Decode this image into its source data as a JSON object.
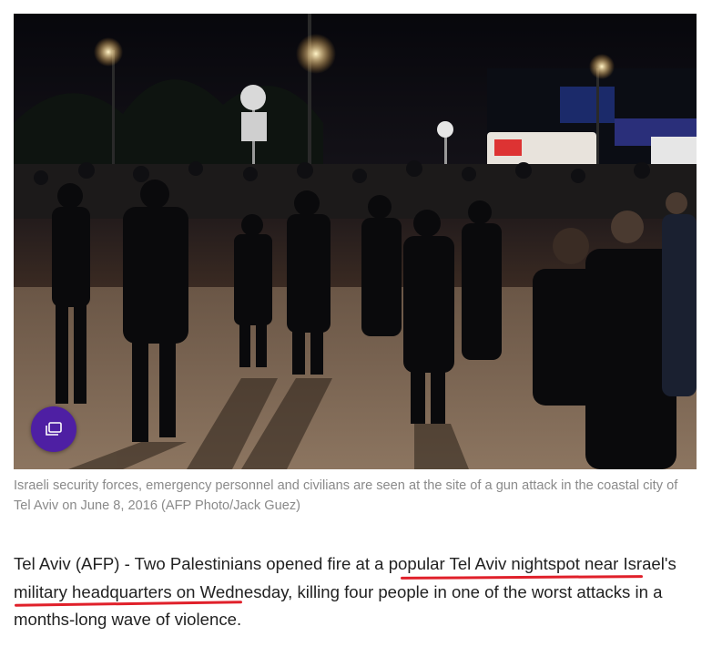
{
  "photo": {
    "alt": "Israeli security forces, emergency personnel and civilians at night scene",
    "gallery_icon": "gallery-icon"
  },
  "caption": {
    "text": "Israeli security forces, emergency personnel and civilians are seen at the site of a gun attack in the coastal city of Tel Aviv on June 8, 2016 (AFP Photo/Jack Guez)"
  },
  "article": {
    "lead_1": "Tel Aviv (AFP) - Two Palestinians opened fire at a ",
    "highlight_1": "popular Tel Aviv nightspot near",
    "lead_2": " ",
    "highlight_2": "Israel's military headquarters",
    "lead_3": " on Wednesday, killing four people in one of the worst attacks in a months-long wave of violence."
  },
  "colors": {
    "gallery_button": "#4e1fa3",
    "annotation_underline": "#e0202a",
    "caption_text": "#8a8a8a",
    "body_text": "#222222"
  }
}
